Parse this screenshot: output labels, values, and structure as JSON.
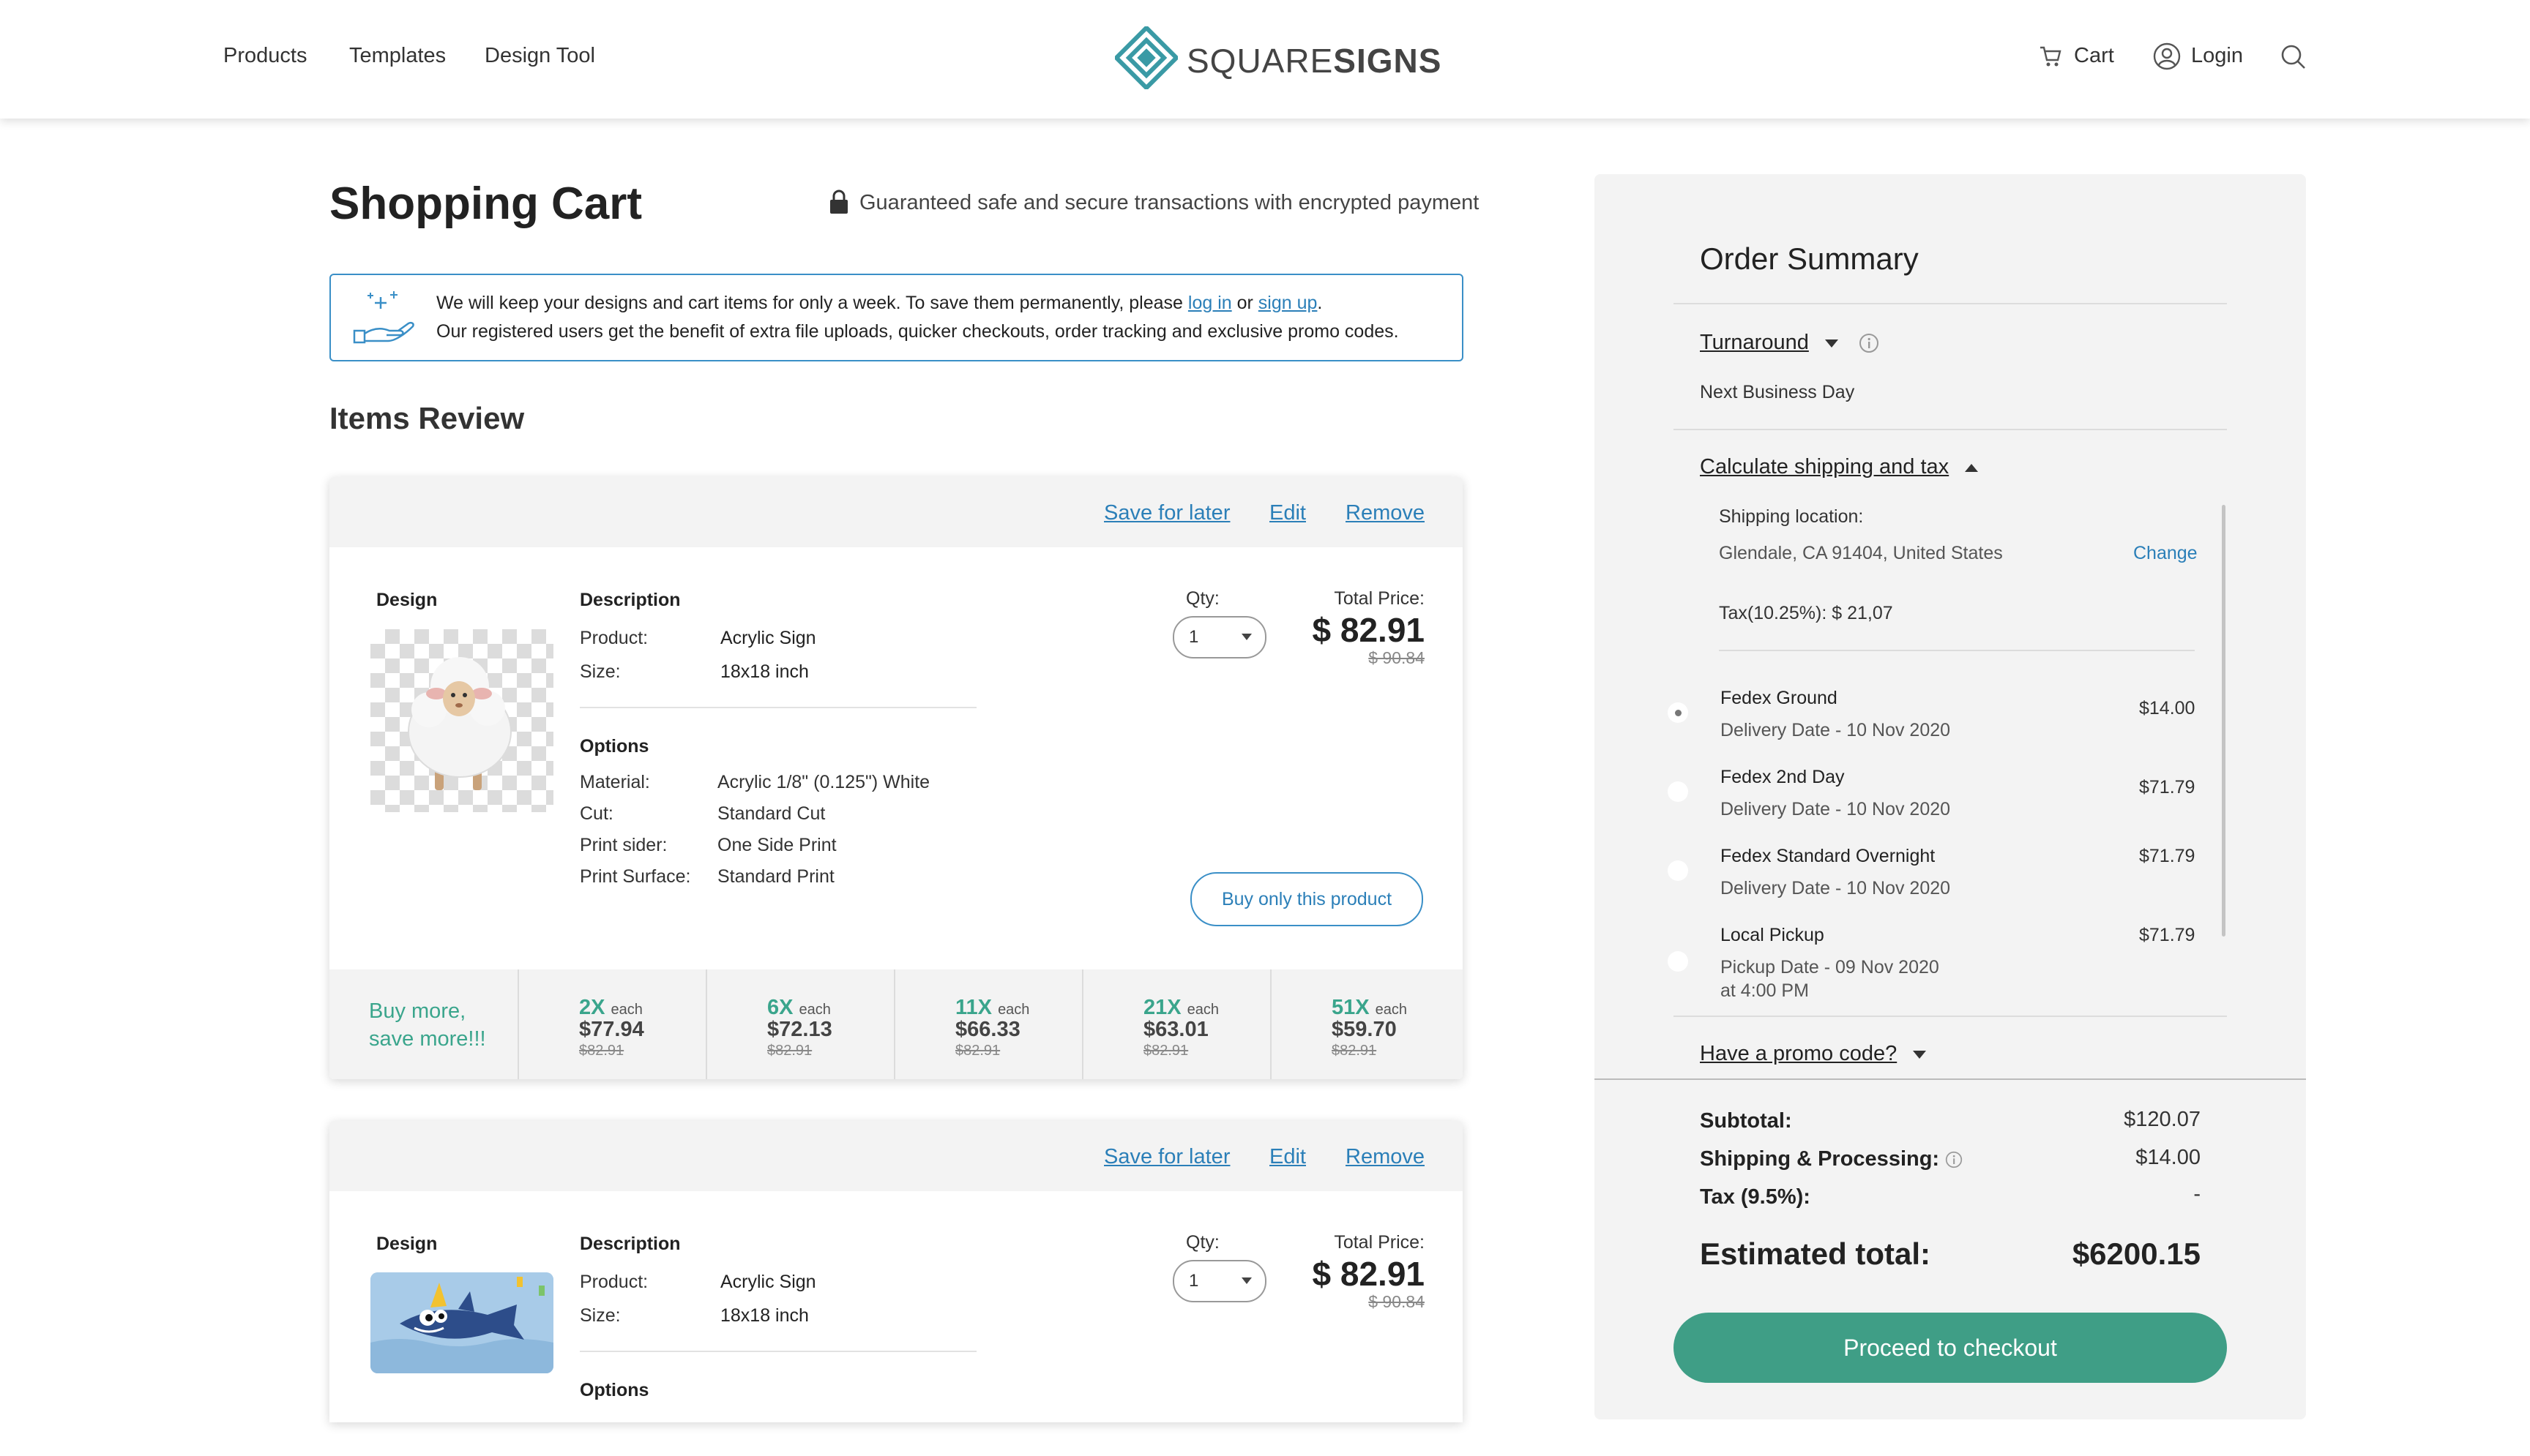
{
  "header": {
    "nav": [
      "Products",
      "Templates",
      "Design Tool"
    ],
    "brand_light": "SQUARE",
    "brand_bold": "SIGNS",
    "cart_label": "Cart",
    "login_label": "Login",
    "brand_color": "#3a9aa5"
  },
  "page": {
    "title": "Shopping Cart",
    "secure_text": "Guaranteed safe and secure transactions with encrypted payment"
  },
  "notice": {
    "line1_pre": "We will keep your designs and cart items for only a week. To save them permanently, please ",
    "login_link": "log in",
    "or": " or ",
    "signup_link": "sign up",
    "line1_end": ".",
    "line2": "Our registered users get the benefit of extra file uploads, quicker checkouts, order tracking and exclusive promo codes."
  },
  "items_review_title": "Items Review",
  "card_labels": {
    "save_for_later": "Save for later",
    "edit": "Edit",
    "remove": "Remove",
    "design": "Design",
    "description": "Description",
    "product": "Product:",
    "size": "Size:",
    "options": "Options",
    "material": "Material:",
    "cut": "Cut:",
    "print_sider": "Print sider:",
    "print_surface": "Print Surface:",
    "qty": "Qty:",
    "total_price": "Total Price:",
    "buy_only": "Buy only this product",
    "buy_more": [
      "Buy more,",
      "save more!!!"
    ],
    "each": "each"
  },
  "items": [
    {
      "product": "Acrylic Sign",
      "size": "18x18 inch",
      "material": "Acrylic 1/8\" (0.125\") White",
      "cut": "Standard Cut",
      "print_sider": "One Side Print",
      "print_surface": "Standard Print",
      "qty": "1",
      "total": "$ 82.91",
      "old_total": "$ 90.84",
      "design_icon": "sheep-icon",
      "tiers": [
        {
          "qty": "2X",
          "price": "$77.94",
          "old": "$82.91"
        },
        {
          "qty": "6X",
          "price": "$72.13",
          "old": "$82.91"
        },
        {
          "qty": "11X",
          "price": "$66.33",
          "old": "$82.91"
        },
        {
          "qty": "21X",
          "price": "$63.01",
          "old": "$82.91"
        },
        {
          "qty": "51X",
          "price": "$59.70",
          "old": "$82.91"
        }
      ]
    },
    {
      "product": "Acrylic Sign",
      "size": "18x18 inch",
      "qty": "1",
      "total": "$ 82.91",
      "old_total": "$ 90.84",
      "design_icon": "shark-icon"
    }
  ],
  "summary": {
    "title": "Order Summary",
    "turnaround_label": "Turnaround",
    "turnaround_value": "Next Business Day",
    "calc_label": "Calculate shipping and tax",
    "shipping_location_label": "Shipping location:",
    "shipping_location": "Glendale, CA 91404, United States",
    "change": "Change",
    "tax_line": "Tax(10.25%):  $ 21,07",
    "shipping_options": [
      {
        "name": "Fedex Ground",
        "date": "Delivery Date - 10 Nov 2020",
        "price": "$14.00",
        "selected": true
      },
      {
        "name": "Fedex 2nd Day",
        "date": "Delivery Date - 10 Nov 2020",
        "price": "$71.79",
        "selected": false
      },
      {
        "name": "Fedex Standard Overnight",
        "date": "Delivery Date - 10 Nov 2020",
        "price": "$71.79",
        "selected": false
      },
      {
        "name": "Local Pickup",
        "date": "Pickup Date - 09 Nov 2020",
        "date2": "at 4:00 PM",
        "price": "$71.79",
        "selected": false
      }
    ],
    "promo_label": "Have a promo code?",
    "subtotal_label": "Subtotal:",
    "subtotal": "$120.07",
    "shipping_label": "Shipping & Processing:",
    "shipping": "$14.00",
    "tax_label": "Tax (9.5%):",
    "tax": "-",
    "est_label": "Estimated total:",
    "est_total": "$6200.15",
    "checkout": "Proceed to checkout",
    "accent_color": "#3f9e86"
  }
}
